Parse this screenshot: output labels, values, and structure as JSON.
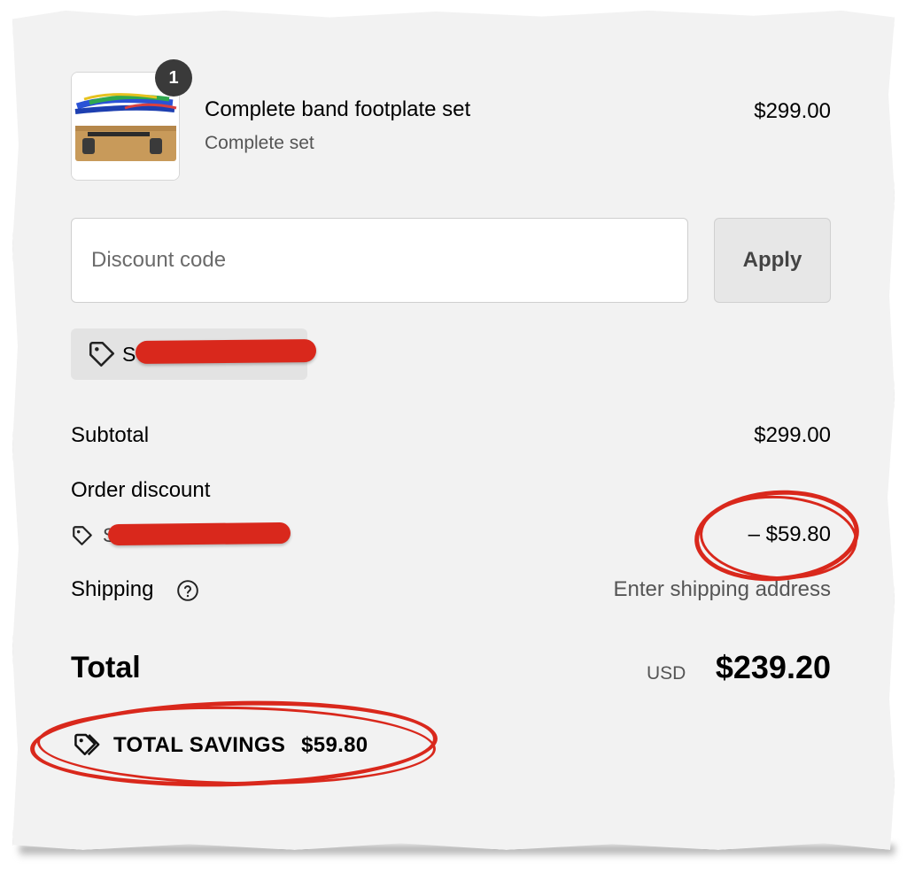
{
  "cart_item": {
    "quantity": "1",
    "name": "Complete band footplate set",
    "variant": "Complete set",
    "price": "$299.00"
  },
  "discount": {
    "placeholder": "Discount code",
    "apply_label": "Apply",
    "applied_code_visible": "S"
  },
  "summary": {
    "subtotal_label": "Subtotal",
    "subtotal_value": "$299.00",
    "order_discount_label": "Order discount",
    "order_discount_code_visible": "S",
    "order_discount_value": "– $59.80",
    "shipping_label": "Shipping",
    "shipping_value": "Enter shipping address",
    "total_label": "Total",
    "total_currency": "USD",
    "total_value": "$239.20",
    "savings_label": "TOTAL SAVINGS",
    "savings_value": "$59.80"
  },
  "icons": {
    "chip": "tag-icon",
    "discount": "tag-icon",
    "shipping_help": "question-circle-icon",
    "savings": "tags-icon"
  },
  "colors": {
    "annotation_red": "#d9281c",
    "panel_bg": "#f2f2f2",
    "badge_bg": "#3a3a3a"
  }
}
